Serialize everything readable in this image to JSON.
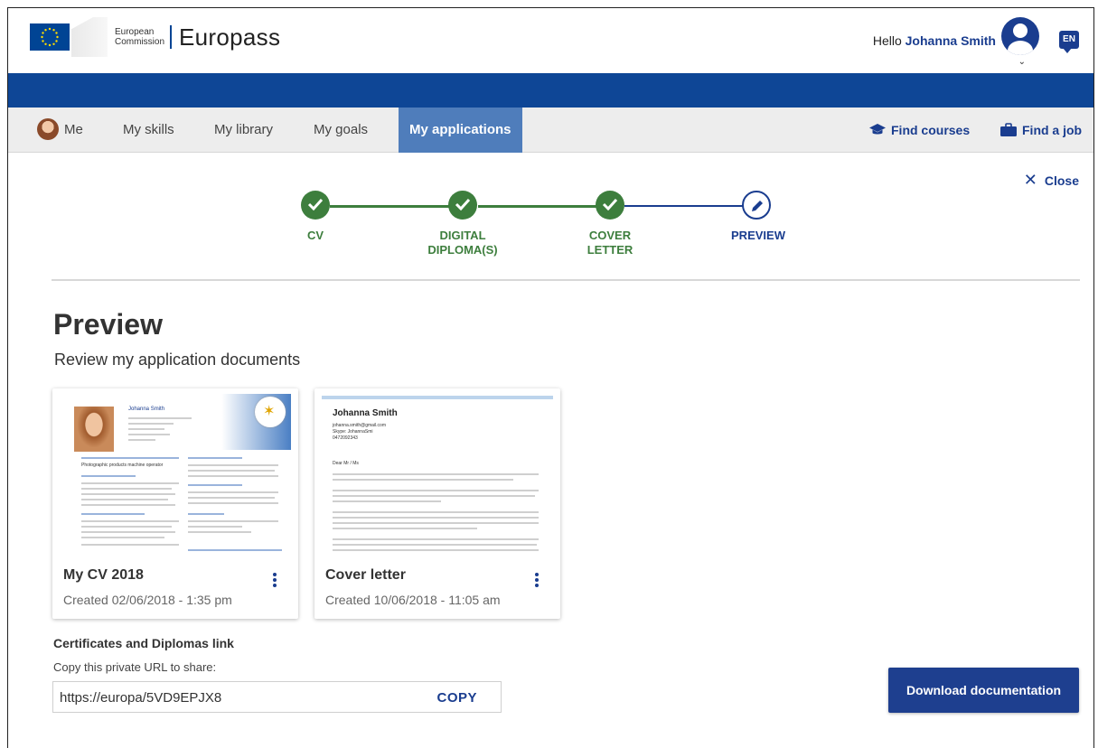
{
  "header": {
    "ec_line1": "European",
    "ec_line2": "Commission",
    "brand": "Europass",
    "greeting": "Hello",
    "user_name": "Johanna Smith",
    "language": "EN"
  },
  "nav": {
    "items": [
      {
        "label": "Me"
      },
      {
        "label": "My skills"
      },
      {
        "label": "My library"
      },
      {
        "label": "My goals"
      },
      {
        "label": "My applications",
        "active": true
      }
    ],
    "find_courses": "Find courses",
    "find_job": "Find a job"
  },
  "close_label": "Close",
  "stepper": {
    "steps": [
      {
        "label": "CV",
        "state": "done"
      },
      {
        "label": "DIGITAL DIPLOMA(S)",
        "state": "done"
      },
      {
        "label": "COVER LETTER",
        "state": "done"
      },
      {
        "label": "PREVIEW",
        "state": "current"
      }
    ]
  },
  "page": {
    "title": "Preview",
    "subtitle": "Review my application documents"
  },
  "documents": [
    {
      "title": "My CV 2018",
      "created": "Created 02/06/2018 - 1:35 pm",
      "thumb_name": "Johanna Smith",
      "thumb_role": "Photographic products machine operator"
    },
    {
      "title": "Cover letter",
      "created": "Created 10/06/2018 - 11:05 am",
      "thumb_name": "Johanna Smith",
      "thumb_email": "johanna.smith@gmail.com",
      "thumb_skype": "Skype: JohannaSmi",
      "thumb_phone": "0472092343",
      "thumb_greeting": "Dear Mr / Ms"
    }
  ],
  "certificates": {
    "title": "Certificates and Diplomas link",
    "subtitle": "Copy this private URL to share:",
    "url": "https://europa/5VD9EPJX8",
    "copy_label": "COPY"
  },
  "download_label": "Download documentation",
  "colors": {
    "primary": "#1a3d8f",
    "band": "#0e4696",
    "active_tab": "#4f7dbb",
    "success": "#3d7e3d"
  }
}
